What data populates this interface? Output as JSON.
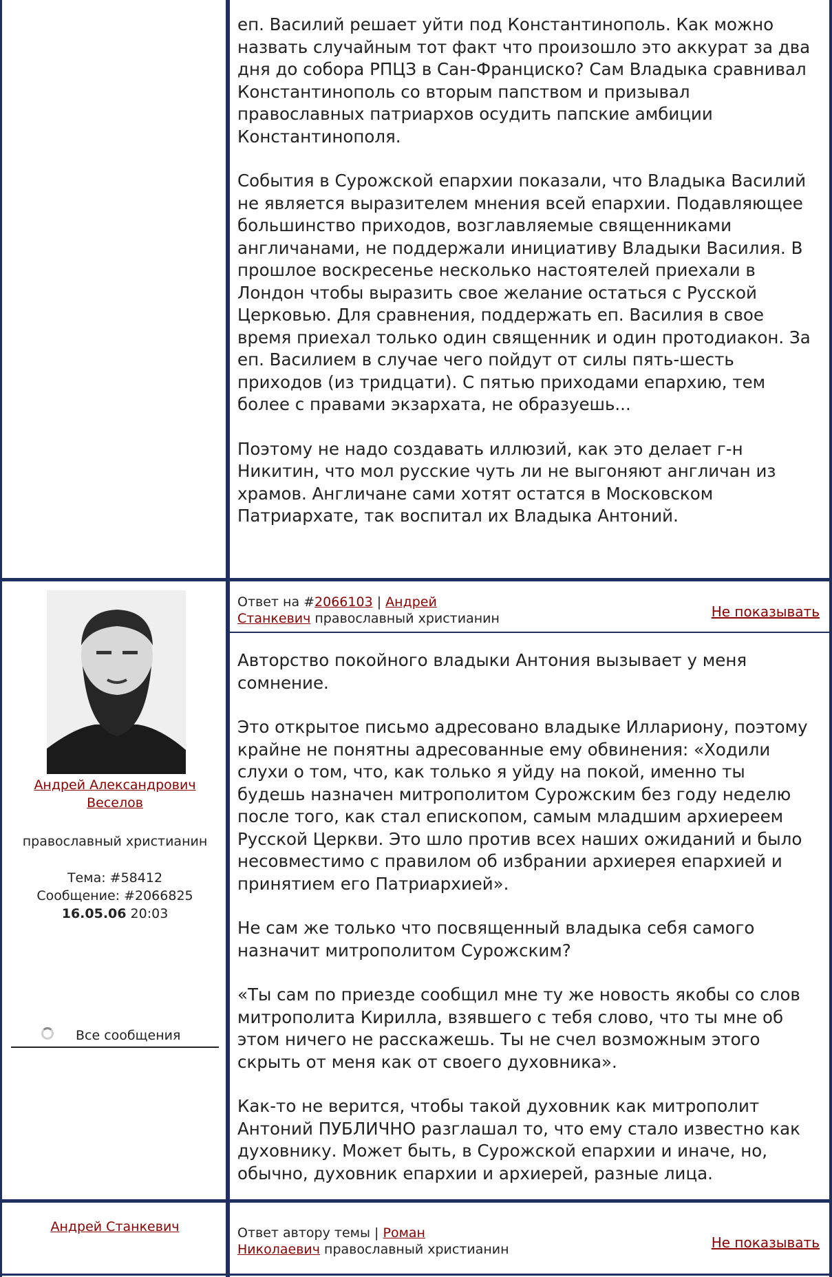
{
  "colors": {
    "frame": "#1f2f5f",
    "link": "#8b0000",
    "text": "#222222"
  },
  "post1": {
    "paragraphs": [
      "еп. Василий решает уйти под Константинополь. Как можно назвать случайным тот факт что произошло это аккурат за два дня до собора РПЦЗ в Сан-Франциско? Сам Владыка сравнивал Константинополь со вторым папством и призывал православных патриархов осудить папские амбиции Константинополя.",
      "События в Сурожской епархии показали, что Владыка Василий не является выразителем мнения всей епархии. Подавляющее большинство приходов, возглавляемые священниками англичанами, не поддержали инициативу Владыки Василия. В прошлое воскресенье несколько настоятелей приехали в Лондон чтобы выразить свое желание остаться с Русской Церковью. Для сравнения, поддержать еп. Василия в свое время приехал только один священник и один протодиакон. За еп. Василием в случае чего пойдут от силы пять-шесть приходов (из тридцати). С пятью приходами епархию, тем более с правами экзархата, не образуешь...",
      "Поэтому не надо создавать иллюзий, как это делает г-н Никитин, что мол русские чуть ли не выгоняют англичан из храмов. Англичане сами хотят остатся в Московском Патриархате, так воспитал их Владыка Антоний."
    ]
  },
  "post2": {
    "reply_prefix": "Ответ на #",
    "reply_id": "2066103",
    "sep": " | ",
    "reply_author_1": "Андрей",
    "reply_author_2": "Станкевич",
    "reply_role": " православный христианин",
    "hide_label": "Не показывать",
    "author_name_1": "Андрей Александрович",
    "author_name_2": "Веселов",
    "author_role": "православный христианин",
    "topic": "Тема: #58412",
    "message": "Сообщение: #2066825",
    "date": "16.05.06",
    "time": " 20:03",
    "all_messages": "Все сообщения",
    "paragraphs": [
      "Авторство покойного владыки Антония вызывает у меня сомнение.",
      "Это открытое письмо адресовано владыке Иллариону, поэтому крайне не понятны адресованные ему обвинения: «Ходили слухи о том, что, как только я уйду на покой, именно ты будешь назначен митрополитом Сурожским без году неделю после того, как стал епископом, самым младшим архиереем Русской Церкви. Это шло против всех наших ожиданий и было несовместимо с правилом об избрании архиерея епархией и принятием его Патриархией».",
      "Не сам же только что посвященный владыка себя самого назначит митрополитом Сурожским?",
      "«Ты сам по приезде сообщил мне ту же новость якобы со слов митрополита Кирилла, взявшего с тебя слово, что ты мне об этом ничего не расскажешь. Ты не счел возможным этого скрыть от меня как от своего духовника».",
      "Как-то не верится, чтобы такой духовник как митрополит Антоний ПУБЛИЧНО разглашал то, что ему стало известно как духовнику. Может быть, в Сурожской епархии и иначе, но, обычно, духовник епархии и архиерей, разные лица."
    ]
  },
  "post3": {
    "author_name": "Андрей Станкевич",
    "reply_prefix": "Ответ автору темы",
    "sep": " | ",
    "reply_author_1": "Роман",
    "reply_author_2": "Николаевич",
    "reply_role": " православный христианин",
    "hide_label": "Не показывать"
  }
}
